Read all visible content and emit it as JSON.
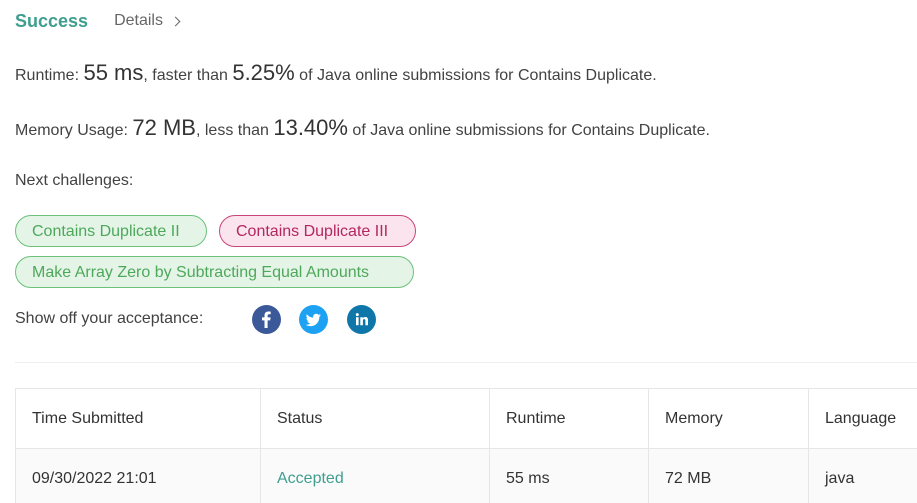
{
  "header": {
    "status_title": "Success",
    "details_label": "Details"
  },
  "runtime_line": {
    "prefix": "Runtime: ",
    "value": "55 ms",
    "middle": ", faster than ",
    "percent": "5.25%",
    "suffix": " of Java online submissions for Contains Duplicate."
  },
  "memory_line": {
    "prefix": "Memory Usage: ",
    "value": "72 MB",
    "middle": ", less than ",
    "percent": "13.40%",
    "suffix": " of Java online submissions for Contains Duplicate."
  },
  "next_challenges": {
    "label": "Next challenges:",
    "items": [
      {
        "label": "Contains Duplicate II",
        "color": "#4ea85c"
      },
      {
        "label": "Contains Duplicate III",
        "color": "#b3275f"
      },
      {
        "label": "Make Array Zero by Subtracting Equal Amounts",
        "color": "#4ea85c"
      }
    ]
  },
  "share": {
    "label": "Show off your acceptance:",
    "icons": [
      "facebook-icon",
      "twitter-icon",
      "linkedin-icon"
    ]
  },
  "table": {
    "headers": [
      "Time Submitted",
      "Status",
      "Runtime",
      "Memory",
      "Language"
    ],
    "rows": [
      {
        "time": "09/30/2022 21:01",
        "status": "Accepted",
        "runtime": "55 ms",
        "memory": "72 MB",
        "language": "java"
      }
    ]
  },
  "colors": {
    "accent": "#3f9e8f",
    "easy_green": "#4ea85c",
    "hard_pink": "#b3275f"
  }
}
